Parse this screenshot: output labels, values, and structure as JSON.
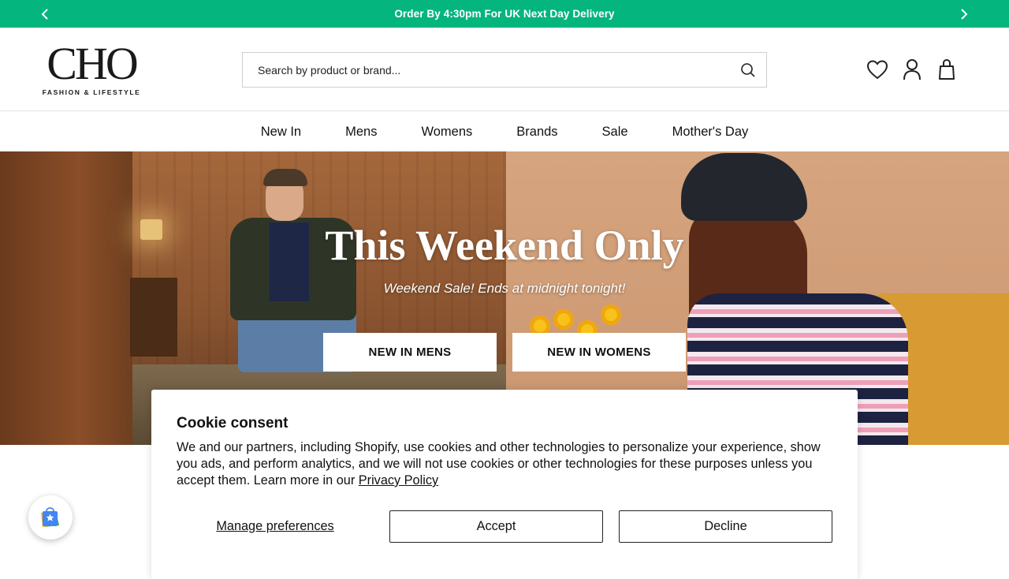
{
  "announcement": {
    "message": "Order By 4:30pm For UK Next Day Delivery",
    "prev_icon": "chevron-left-icon",
    "next_icon": "chevron-right-icon",
    "bg_color": "#04b57e"
  },
  "logo": {
    "mark": "CHO",
    "tagline": "FASHION & LIFESTYLE"
  },
  "search": {
    "placeholder": "Search by product or brand...",
    "icon": "search-icon"
  },
  "header_icons": [
    "heart-icon",
    "account-icon",
    "bag-icon"
  ],
  "nav": {
    "items": [
      "New In",
      "Mens",
      "Womens",
      "Brands",
      "Sale",
      "Mother's Day"
    ]
  },
  "hero": {
    "title": "This Weekend Only",
    "subtitle": "Weekend Sale! Ends at midnight tonight!",
    "buttons": [
      "NEW IN MENS",
      "NEW IN WOMENS"
    ]
  },
  "cookie": {
    "title": "Cookie consent",
    "body": "We and our partners, including Shopify, use cookies and other technologies to personalize your experience, show you ads, and perform analytics, and we will not use cookies or other technologies for these purposes unless you accept them. Learn more in our ",
    "link": "Privacy Policy",
    "manage": "Manage preferences",
    "accept": "Accept",
    "decline": "Decline"
  },
  "fab": {
    "icon": "shop-bag-icon"
  }
}
